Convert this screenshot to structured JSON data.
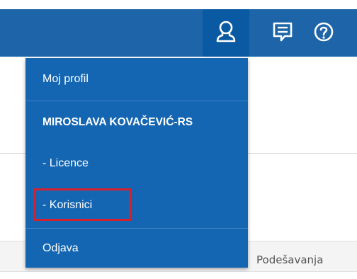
{
  "topbar": {
    "icons": [
      "user-icon",
      "messages-icon",
      "help-icon"
    ],
    "accent_color": "#1d65a8",
    "active_color": "#0a5aa3"
  },
  "dropdown": {
    "my_profile": "Moj profil",
    "user_name": "MIROSLAVA KOVAČEVIĆ-RS",
    "licenses": "-  Licence",
    "users": "-  Korisnici",
    "logout": "Odjava"
  },
  "background": {
    "settings_label": "Podešavanja"
  },
  "highlight_color": "#d7202f"
}
